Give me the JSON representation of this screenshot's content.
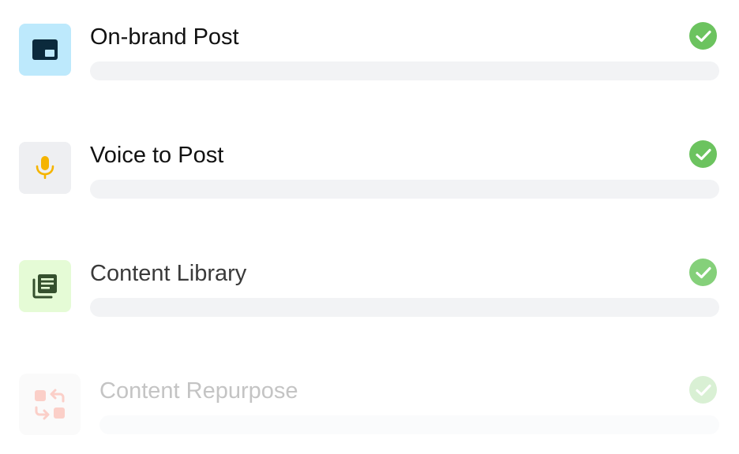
{
  "features": [
    {
      "title": "On-brand Post",
      "icon": "picture-in-picture-icon",
      "tile_color": "#bde9fc",
      "icon_color": "#0b2a3c",
      "title_color": "#111111",
      "check_color": "#6cc35f",
      "completed": true,
      "progress": 0
    },
    {
      "title": "Voice to Post",
      "icon": "microphone-icon",
      "tile_color": "#eeeff2",
      "icon_color": "#f5b400",
      "title_color": "#111111",
      "check_color": "#6cc35f",
      "completed": true,
      "progress": 0
    },
    {
      "title": "Content Library",
      "icon": "library-icon",
      "tile_color": "#e5fbd6",
      "icon_color": "#35502e",
      "title_color": "#3a3a3a",
      "check_color": "#85d07a",
      "completed": true,
      "progress": 0
    },
    {
      "title": "Content Repurpose",
      "icon": "repurpose-swap-icon",
      "tile_color": "#fafafa",
      "icon_color": "#fbcfc8",
      "title_color": "#c4c4c4",
      "check_color": "#d9f0d4",
      "completed": true,
      "progress": 0
    }
  ]
}
